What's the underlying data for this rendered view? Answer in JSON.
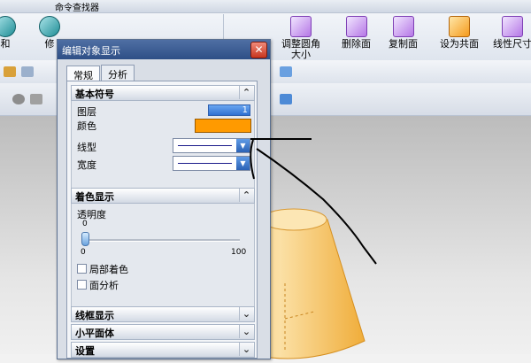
{
  "ribbon": {
    "top_label": "命令查找器",
    "items": [
      {
        "label": "和",
        "icon": "teal-sphere-icon"
      },
      {
        "label": "修",
        "icon": "sphere-icon"
      },
      {
        "label": "调整圆角\n大小",
        "icon": "round-corner-icon"
      },
      {
        "label": "删除面",
        "icon": "delete-face-icon"
      },
      {
        "label": "复制面",
        "icon": "copy-face-icon"
      },
      {
        "label": "设为共面",
        "icon": "coplanar-icon"
      },
      {
        "label": "线性尺寸",
        "icon": "linear-dimension-icon"
      }
    ]
  },
  "dialog": {
    "title": "编辑对象显示",
    "close_glyph": "✕",
    "tabs": [
      "常规",
      "分析"
    ],
    "active_tab": "常规",
    "sections": {
      "basic": {
        "label": "基本符号",
        "expanded": true,
        "layer_label": "图层",
        "layer_value": "1",
        "color_label": "颜色",
        "color_value": "#ff9a00",
        "linetype_label": "线型",
        "width_label": "宽度"
      },
      "shading": {
        "label": "着色显示",
        "expanded": true,
        "transparency_label": "透明度",
        "transparency_value": "0",
        "slider_min": "0",
        "slider_max": "100",
        "local_shading_label": "局部着色",
        "local_shading_checked": false,
        "face_analysis_label": "面分析",
        "face_analysis_checked": false
      },
      "wireframe": {
        "label": "线框显示",
        "expanded": false
      },
      "facets": {
        "label": "小平面体",
        "expanded": false
      },
      "settings": {
        "label": "设置",
        "expanded": false
      }
    }
  },
  "colors": {
    "accent": "#ff9a00",
    "title_bar": "#2e4f86",
    "annotation": "#000000"
  }
}
